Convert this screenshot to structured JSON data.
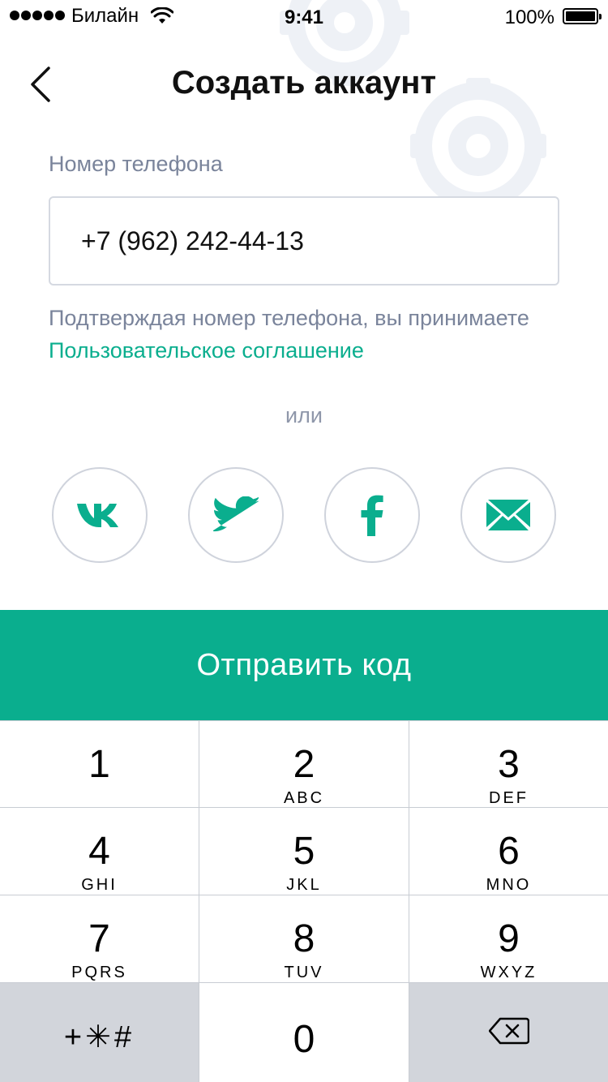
{
  "status_bar": {
    "carrier": "Билайн",
    "time": "9:41",
    "battery": "100%",
    "signal_icon": "signal-dots-icon",
    "wifi_icon": "wifi-icon",
    "battery_icon": "battery-icon"
  },
  "header": {
    "title": "Создать аккаунт",
    "back_icon": "chevron-left-icon"
  },
  "phone": {
    "label": "Номер телефона",
    "value": "+7 (962) 242-44-13"
  },
  "agreement": {
    "text": "Подтверждая номер телефона, вы принимаете ",
    "link": "Пользовательское соглашение"
  },
  "divider_text": "или",
  "social": [
    {
      "icon": "vk-icon"
    },
    {
      "icon": "twitter-icon"
    },
    {
      "icon": "facebook-icon"
    },
    {
      "icon": "mail-icon"
    }
  ],
  "send_button": "Отправить код",
  "keypad": {
    "keys": [
      {
        "digit": "1",
        "letters": ""
      },
      {
        "digit": "2",
        "letters": "ABC"
      },
      {
        "digit": "3",
        "letters": "DEF"
      },
      {
        "digit": "4",
        "letters": "GHI"
      },
      {
        "digit": "5",
        "letters": "JKL"
      },
      {
        "digit": "6",
        "letters": "MNO"
      },
      {
        "digit": "7",
        "letters": "PQRS"
      },
      {
        "digit": "8",
        "letters": "TUV"
      },
      {
        "digit": "9",
        "letters": "WXYZ"
      },
      {
        "digit": "0",
        "letters": ""
      }
    ],
    "symbols": "+✳#",
    "delete_icon": "backspace-icon"
  },
  "colors": {
    "accent": "#0aae8e",
    "label_gray": "#7a849b",
    "border": "#d5d9e1",
    "background_gear": "#eef1f6"
  }
}
